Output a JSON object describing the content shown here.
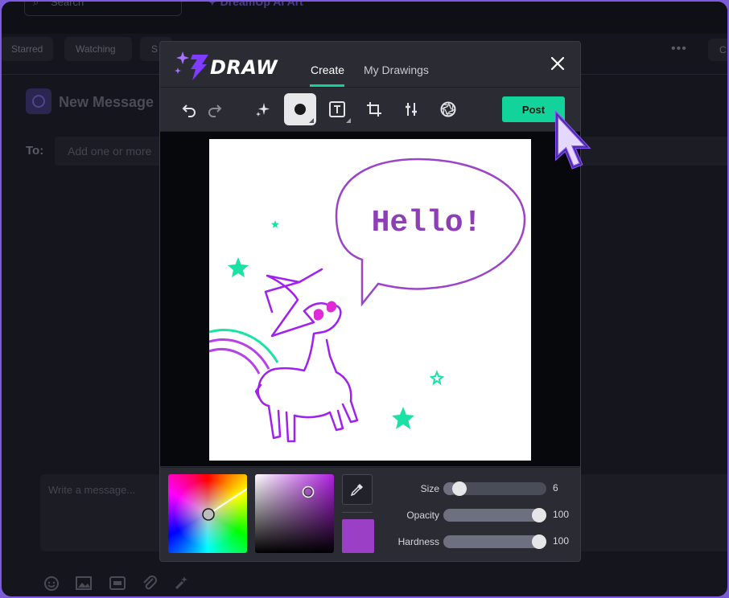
{
  "background": {
    "search_placeholder": "Search",
    "brand": "DreamUp AI Art",
    "tabs": [
      "Starred",
      "Watching",
      "S",
      "C"
    ],
    "title": "New Message",
    "to_label": "To:",
    "to_placeholder": "Add one or more",
    "compose_placeholder": "Write a message..."
  },
  "modal": {
    "logo_text": "DRAW",
    "tabs": [
      {
        "label": "Create",
        "active": true
      },
      {
        "label": "My Drawings",
        "active": false
      }
    ],
    "post_label": "Post",
    "canvas_text": "Hello!",
    "brush_color": "#9b3fc7",
    "accent_color": "#12d39a",
    "sliders": [
      {
        "label": "Size",
        "value": "6",
        "fraction": 0.1
      },
      {
        "label": "Opacity",
        "value": "100",
        "fraction": 1.0
      },
      {
        "label": "Hardness",
        "value": "100",
        "fraction": 1.0
      }
    ]
  }
}
